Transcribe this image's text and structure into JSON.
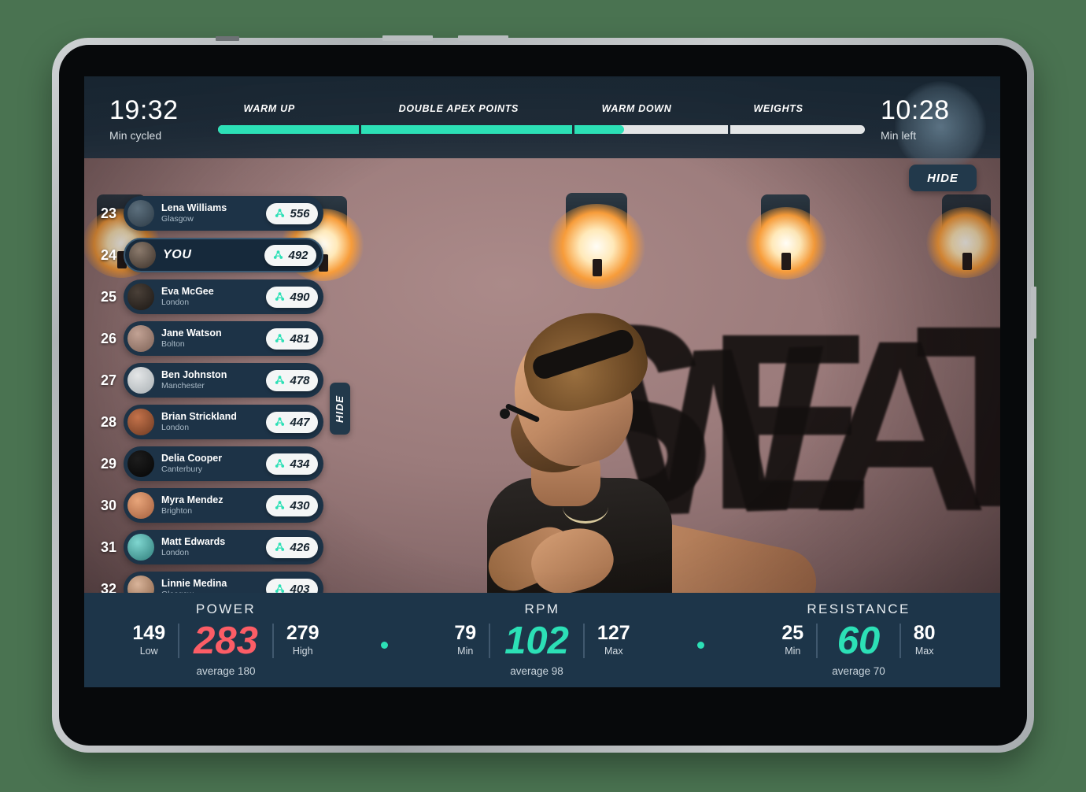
{
  "app": {
    "accent_cyan": "#2ce0b6",
    "accent_coral": "#fc5d66",
    "panel_blue": "#1d3347",
    "bar_blue": "#1d3549",
    "page_background": "#4a7351"
  },
  "header": {
    "elapsed_time": "19:32",
    "elapsed_label": "Min cycled",
    "remaining_time": "10:28",
    "remaining_label": "Min left",
    "hide_label": "HIDE",
    "segments": [
      {
        "label": "WARM UP",
        "width_pct": 22,
        "fill_pct": 100
      },
      {
        "label": "DOUBLE APEX POINTS",
        "width_pct": 33,
        "fill_pct": 100
      },
      {
        "label": "WARM DOWN",
        "width_pct": 24,
        "fill_pct": 32
      },
      {
        "label": "WEIGHTS",
        "width_pct": 21,
        "fill_pct": 0
      }
    ]
  },
  "leaderboard": {
    "hide_label": "HIDE",
    "score_icon": "cluster-icon",
    "rows": [
      {
        "rank": "23",
        "name": "Lena Williams",
        "city": "Glasgow",
        "score": "556",
        "is_you": false,
        "avatar_a": "#5c6f7d",
        "avatar_b": "#2c3a45"
      },
      {
        "rank": "24",
        "name": "YOU",
        "city": "",
        "score": "492",
        "is_you": true,
        "avatar_a": "#8b7a6c",
        "avatar_b": "#3a3029"
      },
      {
        "rank": "25",
        "name": "Eva McGee",
        "city": "London",
        "score": "490",
        "is_you": false,
        "avatar_a": "#4a4038",
        "avatar_b": "#1b1714"
      },
      {
        "rank": "26",
        "name": "Jane Watson",
        "city": "Bolton",
        "score": "481",
        "is_you": false,
        "avatar_a": "#c2a294",
        "avatar_b": "#7d6257"
      },
      {
        "rank": "27",
        "name": "Ben Johnston",
        "city": "Manchester",
        "score": "478",
        "is_you": false,
        "avatar_a": "#e4e6e7",
        "avatar_b": "#a9b0b4"
      },
      {
        "rank": "28",
        "name": "Brian Strickland",
        "city": "London",
        "score": "447",
        "is_you": false,
        "avatar_a": "#c4724a",
        "avatar_b": "#6d3a22"
      },
      {
        "rank": "29",
        "name": "Delia Cooper",
        "city": "Canterbury",
        "score": "434",
        "is_you": false,
        "avatar_a": "#1d1d1d",
        "avatar_b": "#050505"
      },
      {
        "rank": "30",
        "name": "Myra Mendez",
        "city": "Brighton",
        "score": "430",
        "is_you": false,
        "avatar_a": "#e8a57a",
        "avatar_b": "#a35f3d"
      },
      {
        "rank": "31",
        "name": "Matt Edwards",
        "city": "London",
        "score": "426",
        "is_you": false,
        "avatar_a": "#7fd6d0",
        "avatar_b": "#2f7d7a"
      },
      {
        "rank": "32",
        "name": "Linnie Medina",
        "city": "Glasgow",
        "score": "403",
        "is_you": false,
        "avatar_a": "#d9b49a",
        "avatar_b": "#8a6348"
      }
    ]
  },
  "metrics": [
    {
      "title": "POWER",
      "left_stat": {
        "value": "149",
        "label": "Low"
      },
      "main": {
        "value": "283",
        "color": "#fc5d66",
        "average": "average 180"
      },
      "right_stat": {
        "value": "279",
        "label": "High"
      }
    },
    {
      "title": "RPM",
      "left_stat": {
        "value": "79",
        "label": "Min"
      },
      "main": {
        "value": "102",
        "color": "#2ce0b6",
        "average": "average 98"
      },
      "right_stat": {
        "value": "127",
        "label": "Max"
      }
    },
    {
      "title": "RESISTANCE",
      "left_stat": {
        "value": "25",
        "label": "Min"
      },
      "main": {
        "value": "60",
        "color": "#2ce0b6",
        "average": "average 70"
      },
      "right_stat": {
        "value": "80",
        "label": "Max"
      }
    }
  ],
  "video": {
    "wall_text": "SWEAT"
  }
}
